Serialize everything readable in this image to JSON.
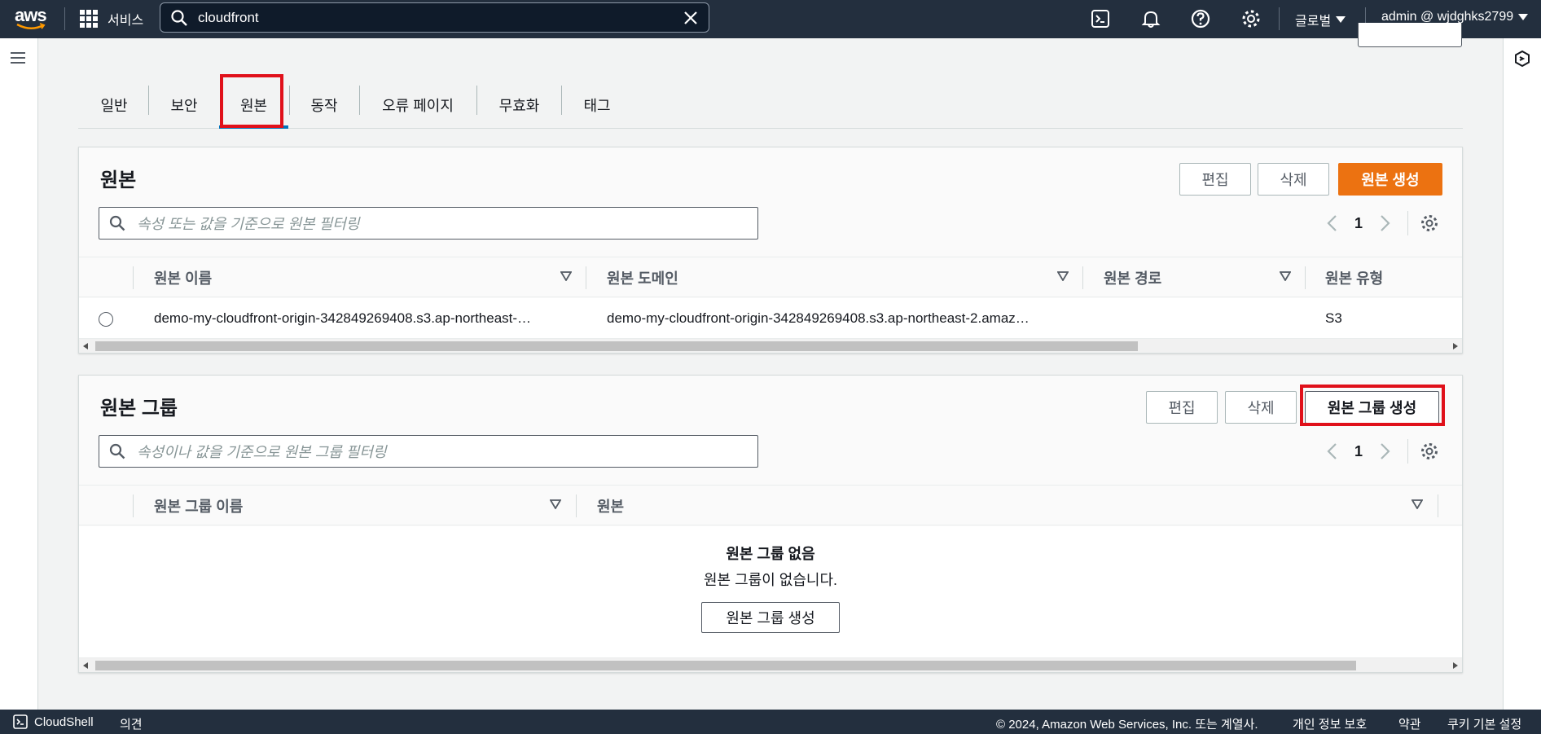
{
  "topnav": {
    "logo_text": "aws",
    "services_label": "서비스",
    "search_value": "cloudfront",
    "region_label": "글로벌",
    "account_label": "admin @ wjdghks2799"
  },
  "tabs": [
    {
      "label": "일반"
    },
    {
      "label": "보안"
    },
    {
      "label": "원본"
    },
    {
      "label": "동작"
    },
    {
      "label": "오류 페이지"
    },
    {
      "label": "무효화"
    },
    {
      "label": "태그"
    }
  ],
  "origins_panel": {
    "title": "원본",
    "edit_label": "편집",
    "delete_label": "삭제",
    "create_label": "원본 생성",
    "filter_placeholder": "속성 또는 값을 기준으로 원본 필터링",
    "page_number": "1",
    "columns": [
      "원본 이름",
      "원본 도메인",
      "원본 경로",
      "원본 유형"
    ],
    "rows": [
      {
        "name": "demo-my-cloudfront-origin-342849269408.s3.ap-northeast-…",
        "domain": "demo-my-cloudfront-origin-342849269408.s3.ap-northeast-2.amaz…",
        "path": "",
        "type": "S3"
      }
    ]
  },
  "groups_panel": {
    "title": "원본 그룹",
    "edit_label": "편집",
    "delete_label": "삭제",
    "create_label": "원본 그룹 생성",
    "filter_placeholder": "속성이나 값을 기준으로 원본 그룹 필터링",
    "page_number": "1",
    "columns": [
      "원본 그룹 이름",
      "원본"
    ],
    "empty_title": "원본 그룹 없음",
    "empty_subtitle": "원본 그룹이 없습니다.",
    "empty_button": "원본 그룹 생성"
  },
  "footer": {
    "cloudshell": "CloudShell",
    "feedback": "의견",
    "copyright": "© 2024, Amazon Web Services, Inc. 또는 계열사.",
    "privacy": "개인 정보 보호",
    "terms": "약관",
    "cookies": "쿠키 기본 설정"
  },
  "colors": {
    "nav_bg": "#232f3e",
    "primary_button": "#ec7211",
    "active_tab": "#0073bb",
    "highlight": "#e0101a"
  },
  "icons": [
    "grid-icon",
    "search-icon",
    "close-icon",
    "cloudshell-icon",
    "bell-icon",
    "help-icon",
    "gear-icon",
    "menu-icon",
    "panel-icon",
    "chevron-left-icon",
    "chevron-right-icon",
    "sort-icon"
  ]
}
